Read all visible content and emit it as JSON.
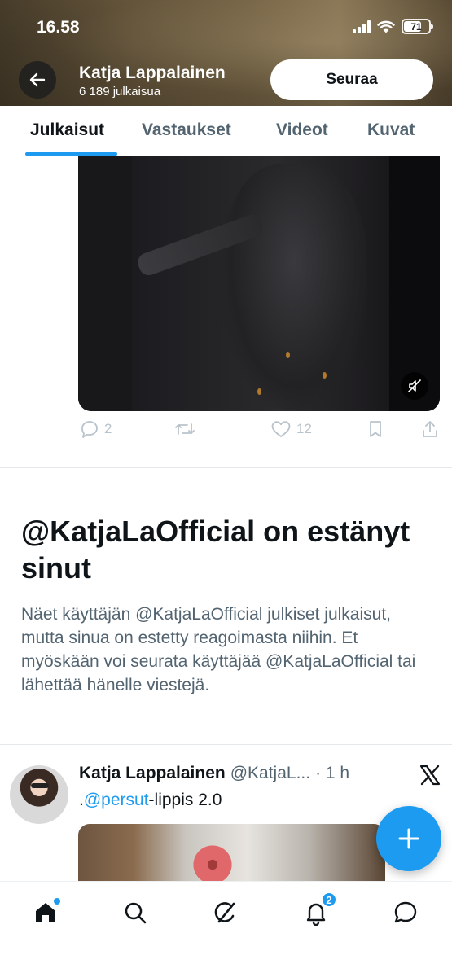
{
  "status_bar": {
    "time": "16.58",
    "battery": "71",
    "battery_level": 0.71
  },
  "header": {
    "back_icon": "arrow-left-icon",
    "profile_name": "Katja Lappalainen",
    "post_count": "6 189 julkaisua",
    "follow_label": "Seuraa"
  },
  "tabs": [
    {
      "label": "Julkaisut",
      "active": true
    },
    {
      "label": "Vastaukset",
      "active": false
    },
    {
      "label": "Videot",
      "active": false
    },
    {
      "label": "Kuvat",
      "active": false
    }
  ],
  "video_post": {
    "mute_icon": "speaker-muted-icon",
    "actions": {
      "replies": "2",
      "reposts": "",
      "likes": "12"
    }
  },
  "blocked_notice": {
    "title": "@KatjaLaOfficial on estänyt sinut",
    "body": "Näet käyttäjän @KatjaLaOfficial julkiset julkaisut, mutta sinua on estetty reagoimasta niihin. Et myöskään voi seurata käyttäjää @KatjaLaOfficial tai lähettää hänelle viestejä."
  },
  "tweet": {
    "name": "Katja Lappalainen",
    "handle": "@KatjaL...",
    "time": "· 1 h",
    "text_prefix": ".",
    "mention": "@persut",
    "text_suffix": "-lippis 2.0"
  },
  "bottom_nav": {
    "items": [
      "home-icon",
      "search-icon",
      "grok-icon",
      "notifications-icon",
      "messages-icon"
    ],
    "notification_badge": "2"
  },
  "colors": {
    "accent": "#1d9bf0",
    "text": "#0f1419",
    "secondary_text": "#536471"
  }
}
